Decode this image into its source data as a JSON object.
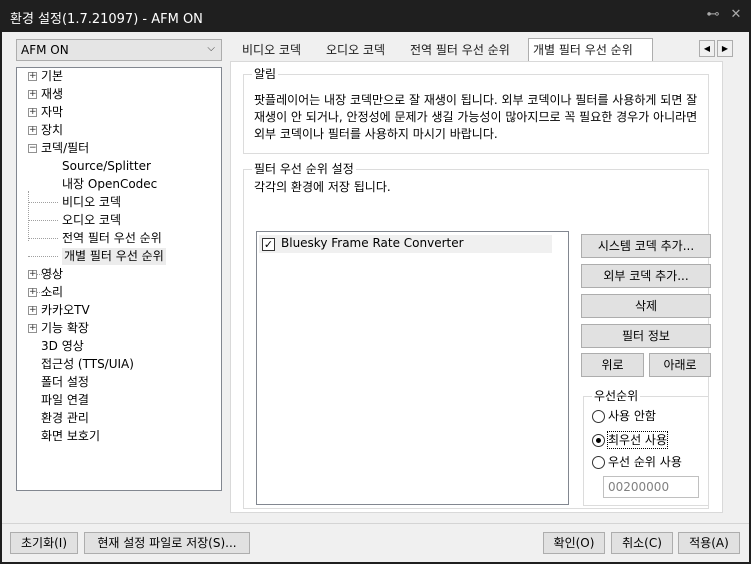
{
  "window": {
    "title": "환경 설정(1.7.21097) - AFM ON",
    "pin_icon": "pin-icon",
    "close_icon": "close-icon"
  },
  "preset": {
    "value": "AFM ON"
  },
  "tree": {
    "items": [
      {
        "label": "기본",
        "expander": "+"
      },
      {
        "label": "재생",
        "expander": "+"
      },
      {
        "label": "자막",
        "expander": "+"
      },
      {
        "label": "장치",
        "expander": "+"
      },
      {
        "label": "코덱/필터",
        "expander": "−"
      },
      {
        "label": "Source/Splitter"
      },
      {
        "label": "내장 OpenCodec"
      },
      {
        "label": "비디오 코덱"
      },
      {
        "label": "오디오 코덱"
      },
      {
        "label": "전역 필터 우선 순위"
      },
      {
        "label": "개별 필터 우선 순위"
      },
      {
        "label": "영상",
        "expander": "+"
      },
      {
        "label": "소리",
        "expander": "+"
      },
      {
        "label": "카카오TV",
        "expander": "+"
      },
      {
        "label": "기능 확장",
        "expander": "+"
      },
      {
        "label": "3D 영상"
      },
      {
        "label": "접근성 (TTS/UIA)"
      },
      {
        "label": "폴더 설정"
      },
      {
        "label": "파일 연결"
      },
      {
        "label": "환경 관리"
      },
      {
        "label": "화면 보호기"
      }
    ]
  },
  "tabs": [
    "비디오 코덱",
    "오디오 코덱",
    "전역 필터 우선 순위",
    "개별 필터 우선 순위"
  ],
  "tab_scroll": {
    "left": "◀",
    "right": "▶"
  },
  "notice": {
    "title": "알림",
    "text": "팟플레이어는 내장 코덱만으로 잘 재생이 됩니다. 외부 코덱이나 필터를 사용하게 되면 잘 재생이 안 되거나, 안정성에 문제가 생길 가능성이 많아지므로 꼭 필요한 경우가 아니라면 외부 코덱이나 필터를 사용하지 마시기 바랍니다."
  },
  "priority": {
    "title": "필터 우선 순위 설정",
    "subtitle": "각각의 환경에 저장 됩니다.",
    "list": [
      {
        "label": "Bluesky Frame Rate Converter",
        "checked": "✓"
      }
    ],
    "buttons": {
      "add_system": "시스템 코덱 추가...",
      "add_external": "외부 코덱 추가...",
      "delete": "삭제",
      "filter_info": "필터 정보",
      "up": "위로",
      "down": "아래로"
    },
    "order": {
      "title": "우선순위",
      "options": [
        "사용 안함",
        "최우선 사용",
        "우선 순위 사용"
      ],
      "selected": "최우선 사용",
      "value": "00200000"
    }
  },
  "footer": {
    "reset": "초기화(I)",
    "save_file": "현재 설정 파일로 저장(S)...",
    "ok": "확인(O)",
    "cancel": "취소(C)",
    "apply": "적용(A)"
  }
}
